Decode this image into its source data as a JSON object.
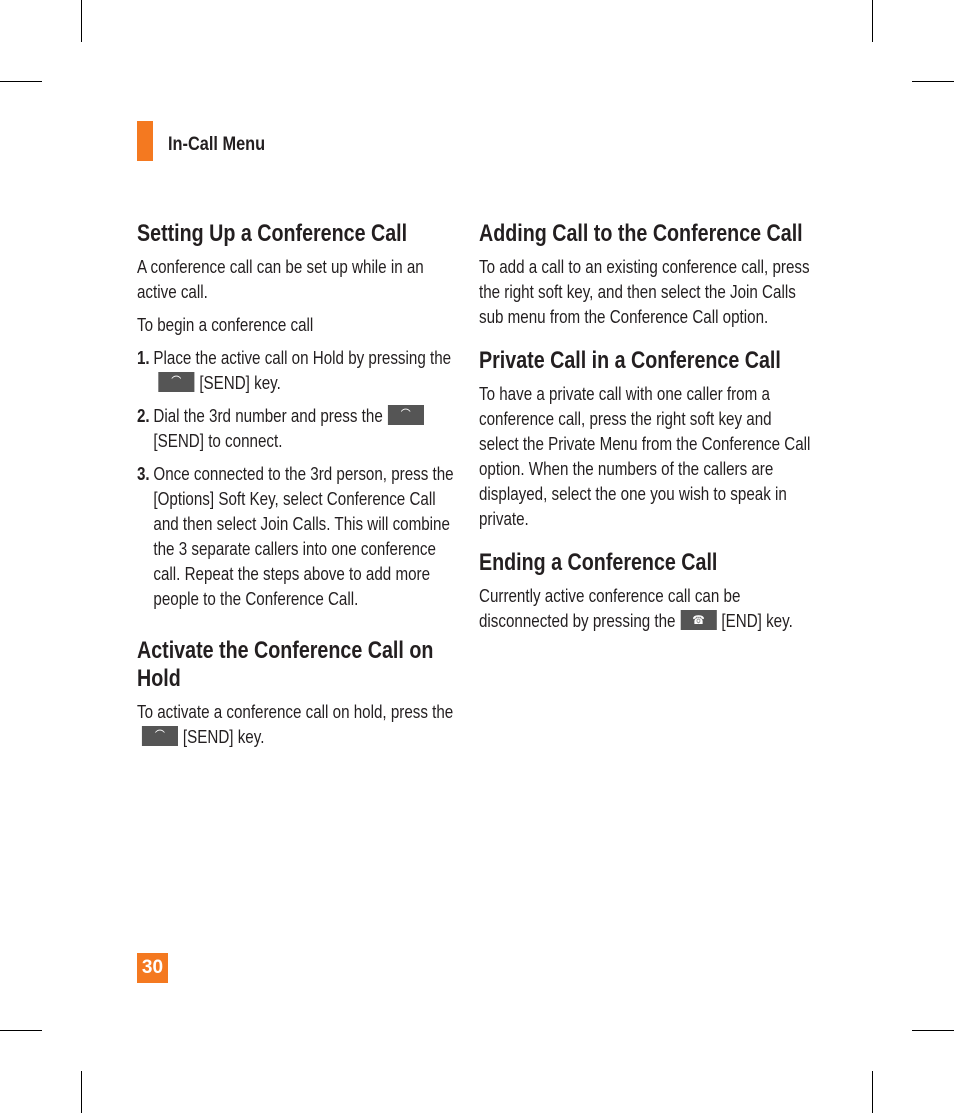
{
  "header": {
    "section_title": "In-Call Menu",
    "accent_color": "#f47920"
  },
  "page_number": "30",
  "icons": {
    "send_key": "send-key-icon",
    "end_key": "end-key-icon"
  },
  "col1": {
    "setup": {
      "title": "Setting Up a Conference Call",
      "intro": "A conference call can be set up while in an active call.",
      "lead": "To begin a conference call",
      "steps": [
        {
          "num": "1.",
          "before": "Place the active call on Hold by pressing the",
          "after": "[SEND] key."
        },
        {
          "num": "2.",
          "before": "Dial the 3rd number and press the",
          "after": "[SEND] to connect."
        },
        {
          "num": "3.",
          "text": "Once connected to the 3rd person, press the [Options] Soft Key, select Conference Call and then select Join Calls.  This will combine the 3 separate callers into one conference call.  Repeat the steps above to add more people to the Conference Call."
        }
      ]
    },
    "hold": {
      "title": "Activate the Conference Call on Hold",
      "before": "To activate a conference call on hold, press the",
      "after": "[SEND] key."
    }
  },
  "col2": {
    "adding": {
      "title": "Adding Call to the Conference Call",
      "body": "To add a call to an existing conference call, press the right soft key, and then select the Join Calls sub menu from the Conference Call option."
    },
    "private": {
      "title": "Private Call in a Conference Call",
      "body": "To have a private call with one caller from a conference call, press the right soft key and select the Private Menu from the Conference Call option. When the numbers of the callers are displayed, select the one you wish to speak in private."
    },
    "ending": {
      "title": "Ending a Conference Call",
      "before": "Currently active conference call can be disconnected by pressing the",
      "after": "[END] key."
    }
  }
}
